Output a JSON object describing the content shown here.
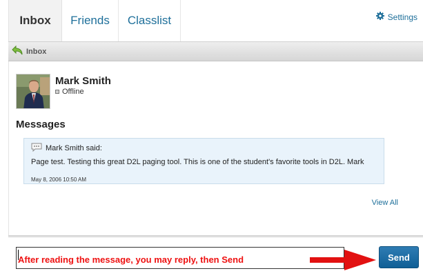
{
  "tabs": [
    {
      "label": "Inbox",
      "active": true
    },
    {
      "label": "Friends",
      "active": false
    },
    {
      "label": "Classlist",
      "active": false
    }
  ],
  "settings_label": "Settings",
  "toolbar": {
    "back_label": "Inbox",
    "icon": "back-arrow-icon"
  },
  "contact": {
    "name": "Mark Smith",
    "status": "Offline"
  },
  "messages": {
    "heading": "Messages",
    "items": [
      {
        "author": "Mark Smith said:",
        "body": "Page test. Testing this great D2L paging tool. This is one of the student's favorite tools in D2L. Mark",
        "date": "May 8, 2006 10:50 AM"
      }
    ],
    "view_all": "View All"
  },
  "reply": {
    "value": "After reading the message, you may reply, then Send",
    "send_label": "Send"
  },
  "colors": {
    "link": "#1e6f9a",
    "annotation": "#ee1111",
    "send_button": "#1a6aa3",
    "message_bg": "#e9f3fb"
  }
}
